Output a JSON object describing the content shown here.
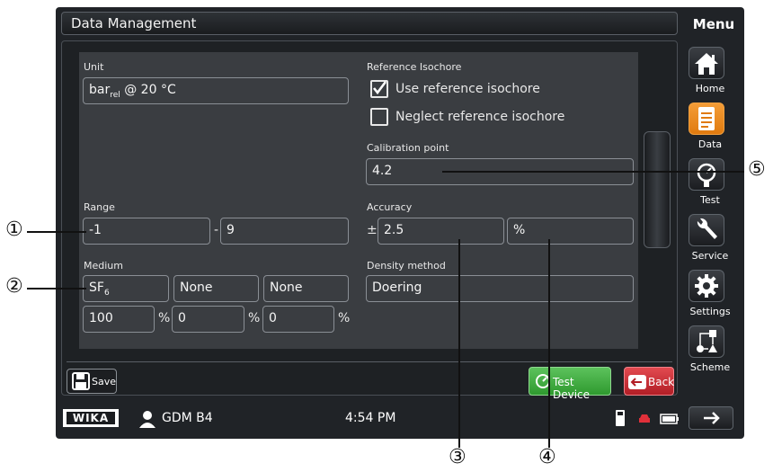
{
  "window_title": "Data Management",
  "menu": {
    "title": "Menu",
    "items": [
      {
        "label": "Home",
        "icon": "home-icon",
        "active": false
      },
      {
        "label": "Data",
        "icon": "data-icon",
        "active": true
      },
      {
        "label": "Test",
        "icon": "test-icon",
        "active": false
      },
      {
        "label": "Service",
        "icon": "wrench-icon",
        "active": false
      },
      {
        "label": "Settings",
        "icon": "gear-icon",
        "active": false
      },
      {
        "label": "Scheme",
        "icon": "scheme-icon",
        "active": false
      }
    ],
    "next_icon": "arrow-right-icon"
  },
  "form": {
    "unit_label": "Unit",
    "unit_main": "bar",
    "unit_sub": "rel",
    "unit_suffix": " @ 20 °C",
    "range_label": "Range",
    "range_min": "-1",
    "range_sep": "-",
    "range_max": "9",
    "medium_label": "Medium",
    "medium_1_main": "SF",
    "medium_1_sub": "6",
    "medium_2": "None",
    "medium_3": "None",
    "medium_pct_1": "100",
    "medium_pct_2": "0",
    "medium_pct_3": "0",
    "pct_symbol": "%",
    "ref_isochore_label": "Reference Isochore",
    "use_ref_isochore": "Use reference isochore",
    "use_ref_checked": true,
    "neglect_ref_isochore": "Neglect reference isochore",
    "neglect_ref_checked": false,
    "calibration_label": "Calibration point",
    "calibration_value": "4.2",
    "accuracy_label": "Accuracy",
    "accuracy_prefix": "±",
    "accuracy_value": "2.5",
    "accuracy_unit": "%",
    "density_label": "Density method",
    "density_value": "Doering"
  },
  "buttons": {
    "save": "Save",
    "test_device": "Test Device",
    "back": "Back"
  },
  "status": {
    "brand": "WIKA",
    "user": "GDM B4",
    "time": "4:54 PM"
  },
  "callouts": [
    "①",
    "②",
    "③",
    "④",
    "⑤"
  ],
  "colors": {
    "active_menu": "#f08a1c",
    "test_button": "#3fa83f",
    "back_button": "#c4262e"
  }
}
